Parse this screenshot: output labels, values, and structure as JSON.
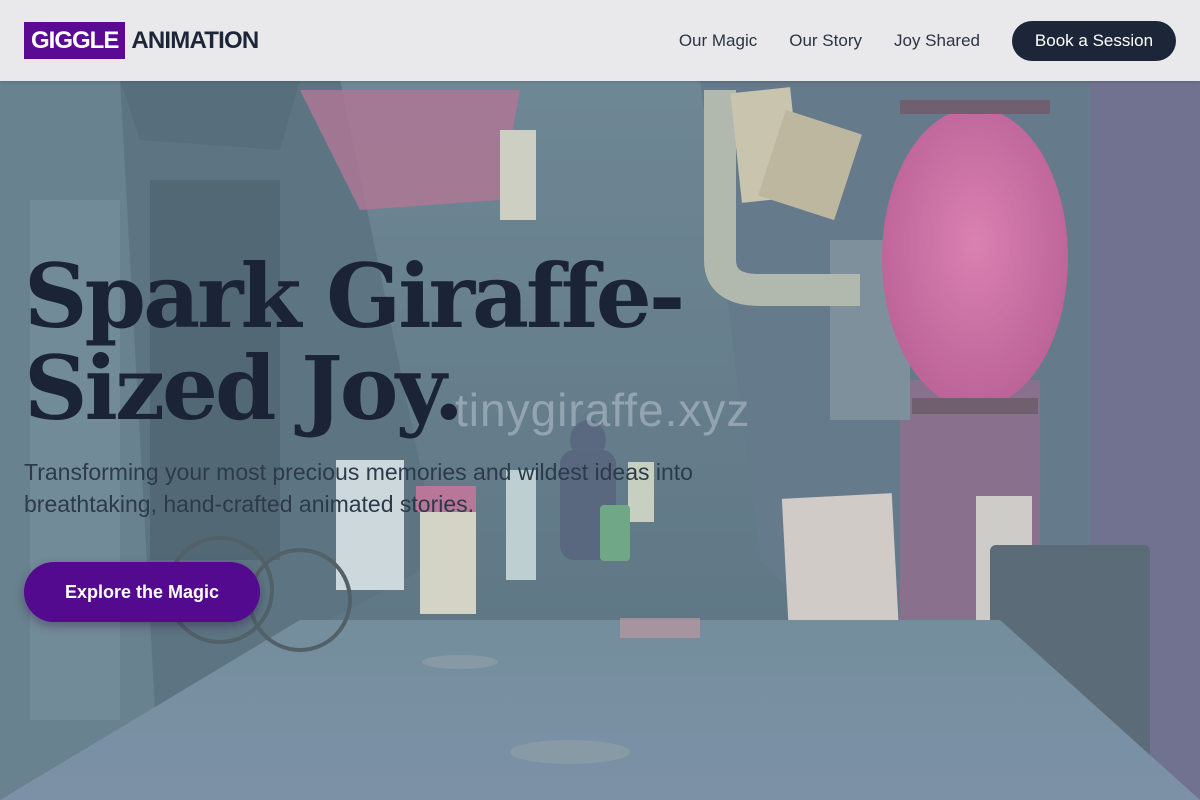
{
  "brand": {
    "logo_box": "GIGGLE",
    "logo_text": "ANIMATION",
    "accent": "#5b0b93"
  },
  "nav": {
    "items": [
      {
        "label": "Our Magic"
      },
      {
        "label": "Our Story"
      },
      {
        "label": "Joy Shared"
      }
    ],
    "cta": "Book a Session"
  },
  "hero": {
    "headline_line1": "Spark Giraffe-",
    "headline_line2": "Sized Joy.",
    "subtext": "Transforming your most precious memories and wildest ideas into breathtaking, hand-crafted animated stories.",
    "cta": "Explore the Magic",
    "watermark": "tinygiraffe.xyz",
    "background": "night-alley-photo"
  },
  "colors": {
    "header_bg": "#e9e9eb",
    "dark_navy": "#1c2638",
    "purple": "#540a8e"
  }
}
